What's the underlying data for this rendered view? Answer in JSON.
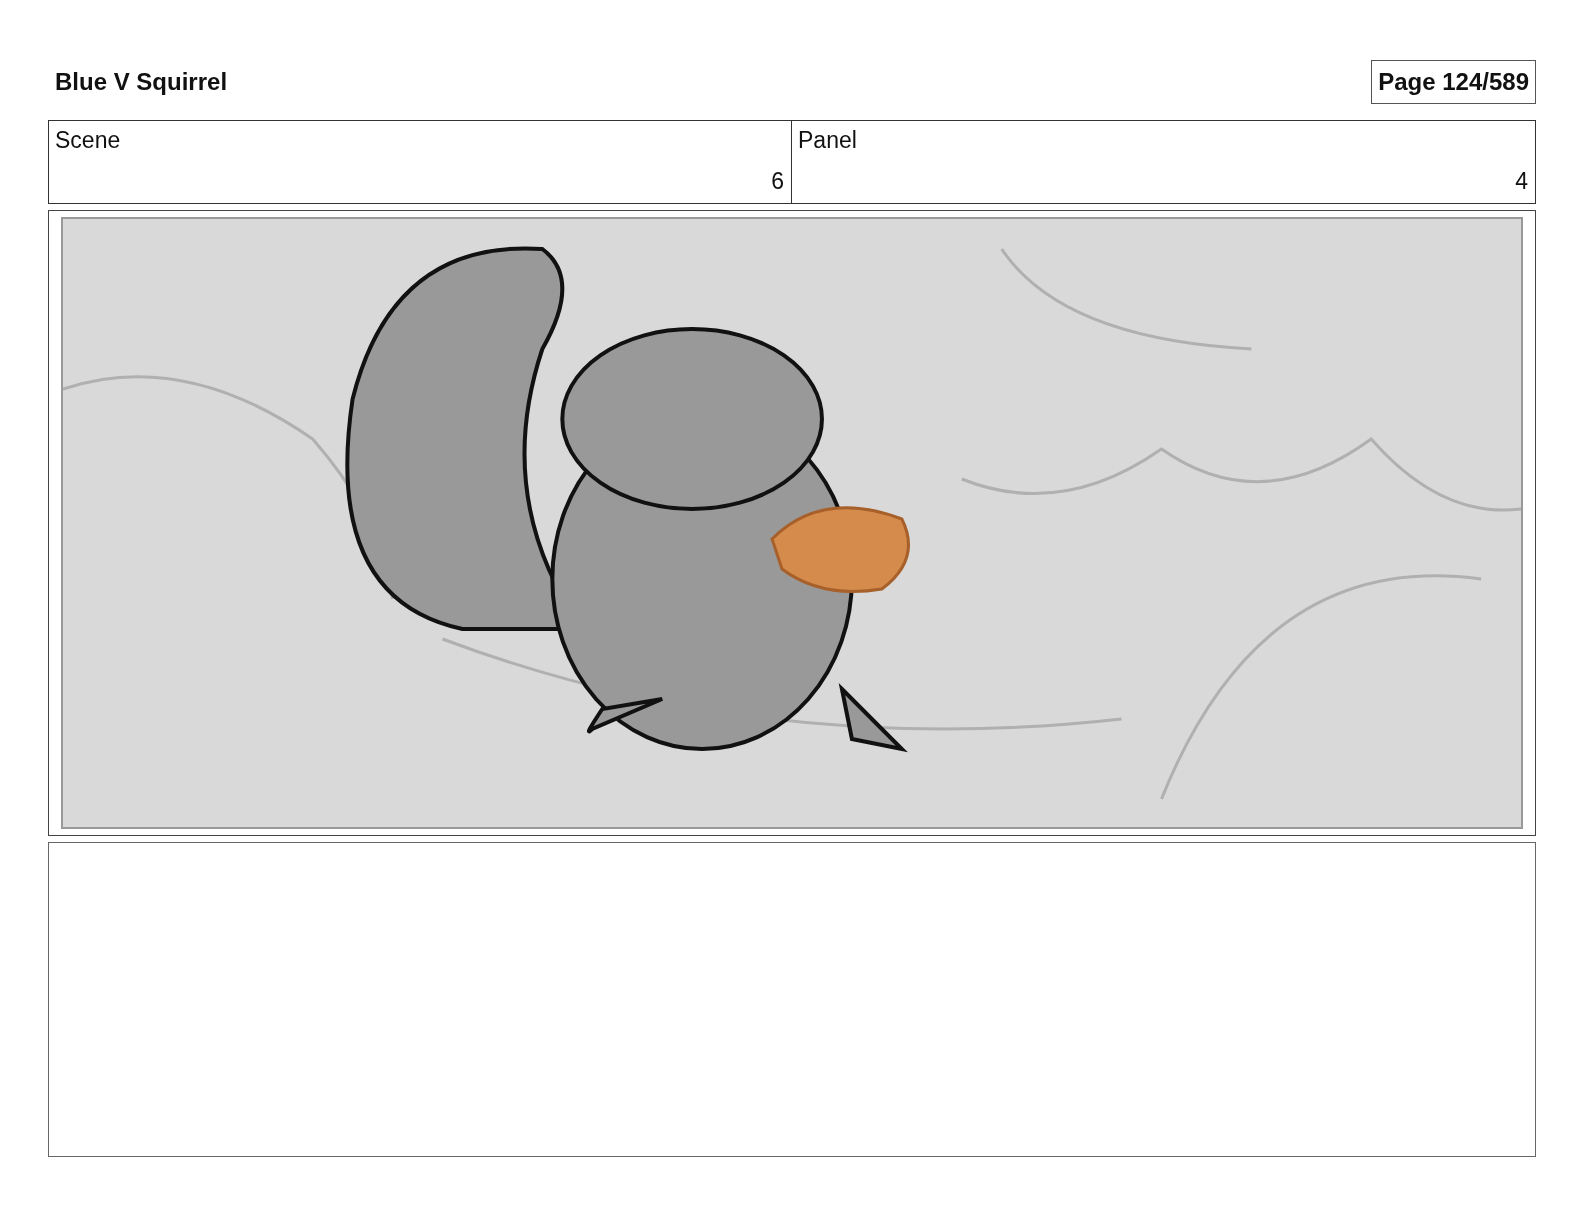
{
  "header": {
    "title": "Blue V Squirrel",
    "page": "Page 124/589"
  },
  "scene": {
    "label": "Scene",
    "number": "6"
  },
  "panel": {
    "label": "Panel",
    "number": "4"
  }
}
